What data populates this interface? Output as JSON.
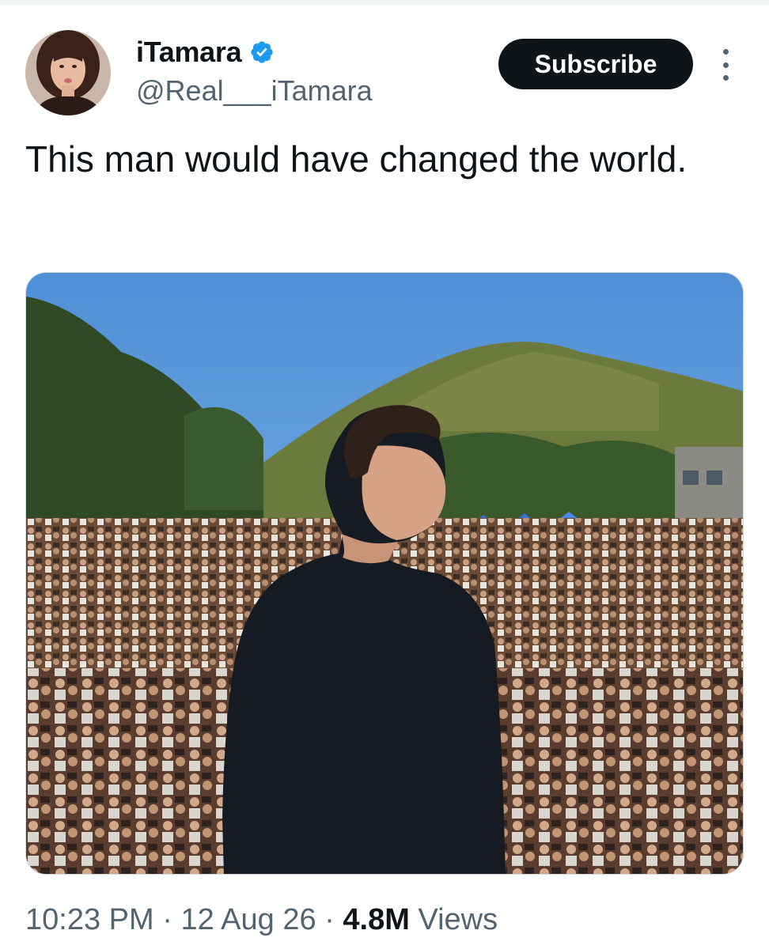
{
  "author": {
    "display_name": "iTamara",
    "handle": "@Real___iTamara",
    "verified_icon": "verified-badge-icon",
    "avatar_icon": "avatar"
  },
  "actions": {
    "subscribe_label": "Subscribe",
    "more_icon": "more-options-icon"
  },
  "tweet": {
    "text": "This man would have changed the world."
  },
  "media": {
    "kind": "photo",
    "alt": ""
  },
  "meta": {
    "time": "10:23 PM",
    "separator": " · ",
    "date": "12 Aug 26",
    "views_count": "4.8M",
    "views_label": "Views"
  },
  "colors": {
    "text_primary": "#0f1419",
    "text_secondary": "#536471",
    "verified_blue": "#1d9bf0",
    "button_bg": "#0f1419"
  }
}
